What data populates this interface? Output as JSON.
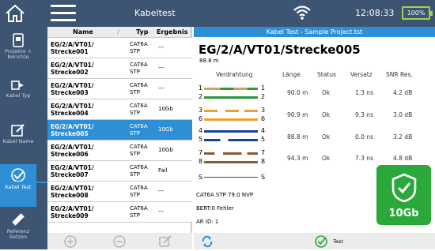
{
  "header": {
    "title": "Kabeltest",
    "time": "12:08:33",
    "battery": "100%"
  },
  "sidebar": [
    {
      "label": "Projekte + Berichte",
      "icon": "phone-icon"
    },
    {
      "label": "Kabel Typ",
      "icon": "connector-icon"
    },
    {
      "label": "Kabel Name",
      "icon": "edit-icon"
    },
    {
      "label": "Kabel Test",
      "icon": "check-icon"
    },
    {
      "label": "Referenz Setzen",
      "icon": "ruler-icon"
    }
  ],
  "list": {
    "headers": {
      "name": "Name",
      "type": "Typ",
      "result": "Ergebnis"
    },
    "rows": [
      {
        "name1": "EG/2/A/VT01/",
        "name2": "Strecke001",
        "type1": "CAT6A",
        "type2": "STP",
        "result": "---"
      },
      {
        "name1": "EG/2/A/VT01/",
        "name2": "Strecke002",
        "type1": "CAT6A",
        "type2": "STP",
        "result": "---"
      },
      {
        "name1": "EG/2/A/VT01/",
        "name2": "Strecke003",
        "type1": "CAT6A",
        "type2": "STP",
        "result": "---"
      },
      {
        "name1": "EG/2/A/VT01/",
        "name2": "Strecke004",
        "type1": "CAT6A",
        "type2": "STP",
        "result": "10Gb"
      },
      {
        "name1": "EG/2/A/VT01/",
        "name2": "Strecke005",
        "type1": "CAT6A",
        "type2": "STP",
        "result": "10Gb"
      },
      {
        "name1": "EG/2/A/VT01/",
        "name2": "Strecke006",
        "type1": "CAT6A",
        "type2": "STP",
        "result": "10Gb"
      },
      {
        "name1": "EG/2/A/VT01/",
        "name2": "Strecke007",
        "type1": "CAT6A",
        "type2": "STP",
        "result": "Fail"
      },
      {
        "name1": "EG/2/A/VT01/",
        "name2": "Strecke008",
        "type1": "CAT6A",
        "type2": "STP",
        "result": "---"
      },
      {
        "name1": "EG/2/A/VT01/",
        "name2": "Strecke009",
        "type1": "CAT6A",
        "type2": "STP",
        "result": "---"
      }
    ]
  },
  "main": {
    "header": "Kabel Test - Sample Project.tst",
    "title": "EG/2/A/VT01/Strecke005",
    "length": "88.8 m",
    "columns": {
      "wiring": "Verdrahtung",
      "length": "Länge",
      "status": "Status",
      "skew": "Versatz",
      "snr": "SNR Res."
    },
    "pairs": [
      {
        "a": "1",
        "b": "2",
        "colors": [
          "#cfa35a",
          "#2a9a3a"
        ],
        "length": "90.0 m",
        "status": "Ok",
        "skew": "1.3 ns",
        "snr": "4.2 dB"
      },
      {
        "a": "3",
        "b": "6",
        "colors": [
          "#f0a030",
          "#f0a030"
        ],
        "length": "90.9 m",
        "status": "Ok",
        "skew": "9.3 ns",
        "snr": "3.0 dB"
      },
      {
        "a": "4",
        "b": "5",
        "colors": [
          "#1a3fa0",
          "#1a3fa0"
        ],
        "length": "88.8 m",
        "status": "Ok",
        "skew": "0.0 ns",
        "snr": "3.2 dB"
      },
      {
        "a": "7",
        "b": "8",
        "colors": [
          "#8a5a30",
          "#8a5a30"
        ],
        "length": "94.3 m",
        "status": "Ok",
        "skew": "7.3 ns",
        "snr": "4.8 dB"
      }
    ],
    "shield": "S",
    "info": [
      "CAT6A STP  79.0 NVP",
      "BERT:0 Fehler",
      "AR ID: 1"
    ],
    "badge": "10Gb",
    "test_label": "Test"
  }
}
